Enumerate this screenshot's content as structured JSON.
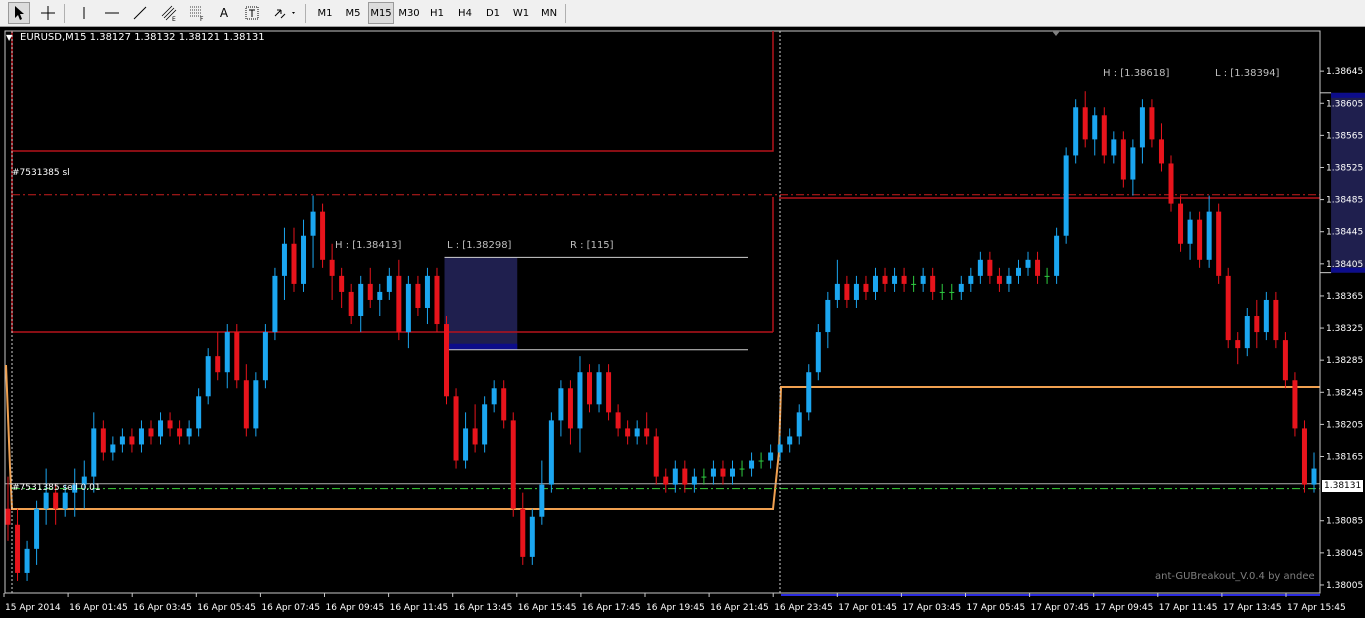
{
  "toolbar": {
    "tools": [
      {
        "name": "cursor-icon"
      },
      {
        "name": "crosshair-icon"
      },
      {
        "name": "vertical-line-icon"
      },
      {
        "name": "horizontal-line-icon"
      },
      {
        "name": "trendline-icon"
      },
      {
        "name": "equidistant-channel-icon"
      },
      {
        "name": "fibonacci-icon"
      },
      {
        "name": "text-icon",
        "label": "A"
      },
      {
        "name": "text-label-icon"
      },
      {
        "name": "arrows-dropdown-icon"
      }
    ],
    "timeframes": [
      "M1",
      "M5",
      "M15",
      "M30",
      "H1",
      "H4",
      "D1",
      "W1",
      "MN"
    ],
    "active_timeframe": "M15"
  },
  "chart": {
    "header": "EURUSD,M15  1.38127 1.38132 1.38121 1.38131",
    "current_price_label": "1.38131",
    "watermark": "ant-GUBreakout_V.0.4 by andee",
    "order_sl_label": "#7531385 sl",
    "order_sell_label": "#7531385 sell 0.01",
    "box1": {
      "high": "H : [1.38413]",
      "low": "L : [1.38298]",
      "range": "R : [115]"
    },
    "box2": {
      "high": "H : [1.38618]",
      "low": "L : [1.38394]"
    },
    "colors": {
      "background": "#000000",
      "bull": "#1ba6f0",
      "bear": "#e8141c",
      "range_box": "#1f1f4e",
      "channel": "#b5121b",
      "orange": "#f0a050",
      "grid_text": "#ffffff",
      "dash_green": "#3ad03a"
    }
  },
  "chart_data": {
    "type": "candlestick",
    "symbol": "EURUSD",
    "timeframe": "M15",
    "ylim": [
      1.37995,
      1.38695
    ],
    "y_ticks": [
      "1.38645",
      "1.38605",
      "1.38565",
      "1.38525",
      "1.38485",
      "1.38445",
      "1.38405",
      "1.38365",
      "1.38325",
      "1.38285",
      "1.38245",
      "1.38205",
      "1.38165",
      "1.38131",
      "1.38085",
      "1.38045",
      "1.38005"
    ],
    "x_ticks": [
      "15 Apr 2014",
      "16 Apr 01:45",
      "16 Apr 03:45",
      "16 Apr 05:45",
      "16 Apr 07:45",
      "16 Apr 09:45",
      "16 Apr 11:45",
      "16 Apr 13:45",
      "16 Apr 15:45",
      "16 Apr 17:45",
      "16 Apr 19:45",
      "16 Apr 21:45",
      "16 Apr 23:45",
      "17 Apr 01:45",
      "17 Apr 03:45",
      "17 Apr 05:45",
      "17 Apr 07:45",
      "17 Apr 09:45",
      "17 Apr 11:45",
      "17 Apr 13:45",
      "17 Apr 15:45"
    ],
    "levels": {
      "order_sl": 1.38491,
      "order_entry": 1.38125,
      "current_bid": 1.38131,
      "box1_high": 1.38413,
      "box1_low": 1.38298,
      "box2_high": 1.38618,
      "box2_low": 1.38394
    },
    "candles": [
      [
        1.381,
        1.3814,
        1.3806,
        1.3808
      ],
      [
        1.3808,
        1.381,
        1.3801,
        1.3802
      ],
      [
        1.3802,
        1.3806,
        1.3801,
        1.3805
      ],
      [
        1.3805,
        1.3811,
        1.3803,
        1.381
      ],
      [
        1.381,
        1.3815,
        1.3808,
        1.3812
      ],
      [
        1.3812,
        1.3813,
        1.3808,
        1.381
      ],
      [
        1.381,
        1.3813,
        1.3809,
        1.3812
      ],
      [
        1.3812,
        1.3815,
        1.3809,
        1.3813
      ],
      [
        1.3813,
        1.3816,
        1.381,
        1.3814
      ],
      [
        1.3814,
        1.3822,
        1.3812,
        1.382
      ],
      [
        1.382,
        1.3821,
        1.3816,
        1.3817
      ],
      [
        1.3817,
        1.3819,
        1.3816,
        1.3818
      ],
      [
        1.3818,
        1.382,
        1.3817,
        1.3819
      ],
      [
        1.3819,
        1.382,
        1.3817,
        1.3818
      ],
      [
        1.3818,
        1.3821,
        1.3817,
        1.382
      ],
      [
        1.382,
        1.3821,
        1.3818,
        1.3819
      ],
      [
        1.3819,
        1.3822,
        1.3818,
        1.3821
      ],
      [
        1.3821,
        1.3822,
        1.3819,
        1.382
      ],
      [
        1.382,
        1.3821,
        1.3818,
        1.3819
      ],
      [
        1.3819,
        1.3821,
        1.3818,
        1.382
      ],
      [
        1.382,
        1.3825,
        1.3819,
        1.3824
      ],
      [
        1.3824,
        1.383,
        1.3823,
        1.3829
      ],
      [
        1.3829,
        1.3832,
        1.3826,
        1.3827
      ],
      [
        1.3827,
        1.3833,
        1.3825,
        1.3832
      ],
      [
        1.3832,
        1.3833,
        1.3825,
        1.3826
      ],
      [
        1.3826,
        1.3828,
        1.3819,
        1.382
      ],
      [
        1.382,
        1.3827,
        1.3819,
        1.3826
      ],
      [
        1.3826,
        1.3833,
        1.3825,
        1.3832
      ],
      [
        1.3832,
        1.384,
        1.3831,
        1.3839
      ],
      [
        1.3839,
        1.3845,
        1.3836,
        1.3843
      ],
      [
        1.3843,
        1.3845,
        1.3837,
        1.3838
      ],
      [
        1.3838,
        1.3846,
        1.3837,
        1.3844
      ],
      [
        1.3844,
        1.3849,
        1.384,
        1.3847
      ],
      [
        1.3847,
        1.3848,
        1.384,
        1.3841
      ],
      [
        1.3841,
        1.3843,
        1.3836,
        1.3839
      ],
      [
        1.3839,
        1.384,
        1.3835,
        1.3837
      ],
      [
        1.3837,
        1.3838,
        1.3833,
        1.3834
      ],
      [
        1.3834,
        1.3839,
        1.3832,
        1.3838
      ],
      [
        1.3838,
        1.384,
        1.3835,
        1.3836
      ],
      [
        1.3836,
        1.3838,
        1.3834,
        1.3837
      ],
      [
        1.3837,
        1.384,
        1.3836,
        1.3839
      ],
      [
        1.3839,
        1.3841,
        1.3831,
        1.3832
      ],
      [
        1.3832,
        1.3839,
        1.383,
        1.3838
      ],
      [
        1.3838,
        1.3839,
        1.3834,
        1.3835
      ],
      [
        1.3835,
        1.384,
        1.3833,
        1.3839
      ],
      [
        1.3839,
        1.384,
        1.3832,
        1.3833
      ],
      [
        1.3833,
        1.3834,
        1.3823,
        1.3824
      ],
      [
        1.3824,
        1.3825,
        1.3815,
        1.3816
      ],
      [
        1.3816,
        1.3822,
        1.3815,
        1.382
      ],
      [
        1.382,
        1.3823,
        1.3817,
        1.3818
      ],
      [
        1.3818,
        1.3824,
        1.3817,
        1.3823
      ],
      [
        1.3823,
        1.3826,
        1.3822,
        1.3825
      ],
      [
        1.3825,
        1.3826,
        1.382,
        1.3821
      ],
      [
        1.3821,
        1.3822,
        1.3809,
        1.381
      ],
      [
        1.381,
        1.3812,
        1.3803,
        1.3804
      ],
      [
        1.3804,
        1.381,
        1.3803,
        1.3809
      ],
      [
        1.3809,
        1.3816,
        1.3808,
        1.3813
      ],
      [
        1.3813,
        1.3822,
        1.3812,
        1.3821
      ],
      [
        1.3821,
        1.3826,
        1.3819,
        1.3825
      ],
      [
        1.3825,
        1.3826,
        1.3818,
        1.382
      ],
      [
        1.382,
        1.3829,
        1.3817,
        1.3827
      ],
      [
        1.3827,
        1.3828,
        1.3822,
        1.3823
      ],
      [
        1.3823,
        1.3828,
        1.3822,
        1.3827
      ],
      [
        1.3827,
        1.3828,
        1.3821,
        1.3822
      ],
      [
        1.3822,
        1.3823,
        1.3819,
        1.382
      ],
      [
        1.382,
        1.3821,
        1.3818,
        1.3819
      ],
      [
        1.3819,
        1.3821,
        1.3818,
        1.382
      ],
      [
        1.382,
        1.3822,
        1.3818,
        1.3819
      ],
      [
        1.3819,
        1.382,
        1.3813,
        1.3814
      ],
      [
        1.3814,
        1.3815,
        1.3812,
        1.3813
      ],
      [
        1.3813,
        1.3816,
        1.3812,
        1.3815
      ],
      [
        1.3815,
        1.3816,
        1.3812,
        1.3813
      ],
      [
        1.3813,
        1.3815,
        1.3812,
        1.3814
      ],
      [
        1.3814,
        1.3815,
        1.3813,
        1.3814
      ],
      [
        1.3814,
        1.3816,
        1.3813,
        1.3815
      ],
      [
        1.3815,
        1.3816,
        1.3813,
        1.3814
      ],
      [
        1.3814,
        1.3816,
        1.3813,
        1.3815
      ],
      [
        1.3815,
        1.3816,
        1.3814,
        1.3815
      ],
      [
        1.3815,
        1.3817,
        1.3814,
        1.3816
      ],
      [
        1.3816,
        1.3817,
        1.3815,
        1.3816
      ],
      [
        1.3816,
        1.3818,
        1.3815,
        1.3817
      ],
      [
        1.3817,
        1.3819,
        1.3816,
        1.3818
      ],
      [
        1.3818,
        1.382,
        1.3817,
        1.3819
      ],
      [
        1.3819,
        1.3823,
        1.3818,
        1.3822
      ],
      [
        1.3822,
        1.3828,
        1.3821,
        1.3827
      ],
      [
        1.3827,
        1.3833,
        1.3826,
        1.3832
      ],
      [
        1.3832,
        1.3837,
        1.383,
        1.3836
      ],
      [
        1.3836,
        1.3841,
        1.3835,
        1.3838
      ],
      [
        1.3838,
        1.3839,
        1.3835,
        1.3836
      ],
      [
        1.3836,
        1.3839,
        1.3835,
        1.3838
      ],
      [
        1.3838,
        1.3839,
        1.3836,
        1.3837
      ],
      [
        1.3837,
        1.384,
        1.3836,
        1.3839
      ],
      [
        1.3839,
        1.384,
        1.3837,
        1.3838
      ],
      [
        1.3838,
        1.384,
        1.3837,
        1.3839
      ],
      [
        1.3839,
        1.384,
        1.3837,
        1.3838
      ],
      [
        1.3838,
        1.3839,
        1.3837,
        1.3838
      ],
      [
        1.3838,
        1.384,
        1.3837,
        1.3839
      ],
      [
        1.3839,
        1.384,
        1.3836,
        1.3837
      ],
      [
        1.3837,
        1.3838,
        1.3836,
        1.3837
      ],
      [
        1.3837,
        1.3838,
        1.3836,
        1.3837
      ],
      [
        1.3837,
        1.3839,
        1.3836,
        1.3838
      ],
      [
        1.3838,
        1.384,
        1.3837,
        1.3839
      ],
      [
        1.3839,
        1.3842,
        1.3838,
        1.3841
      ],
      [
        1.3841,
        1.3842,
        1.3838,
        1.3839
      ],
      [
        1.3839,
        1.384,
        1.3837,
        1.3838
      ],
      [
        1.3838,
        1.384,
        1.3837,
        1.3839
      ],
      [
        1.3839,
        1.3841,
        1.3838,
        1.384
      ],
      [
        1.384,
        1.3842,
        1.3839,
        1.3841
      ],
      [
        1.3841,
        1.3842,
        1.3838,
        1.3839
      ],
      [
        1.3839,
        1.384,
        1.3838,
        1.3839
      ],
      [
        1.3839,
        1.3845,
        1.3838,
        1.3844
      ],
      [
        1.3844,
        1.3855,
        1.3843,
        1.3854
      ],
      [
        1.3854,
        1.3861,
        1.3853,
        1.386
      ],
      [
        1.386,
        1.3862,
        1.3855,
        1.3856
      ],
      [
        1.3856,
        1.386,
        1.3854,
        1.3859
      ],
      [
        1.3859,
        1.386,
        1.3853,
        1.3854
      ],
      [
        1.3854,
        1.3857,
        1.3853,
        1.3856
      ],
      [
        1.3856,
        1.3857,
        1.385,
        1.3851
      ],
      [
        1.3851,
        1.3856,
        1.3849,
        1.3855
      ],
      [
        1.3855,
        1.3861,
        1.3853,
        1.386
      ],
      [
        1.386,
        1.3861,
        1.3855,
        1.3856
      ],
      [
        1.3856,
        1.3858,
        1.3852,
        1.3853
      ],
      [
        1.3853,
        1.3854,
        1.3847,
        1.3848
      ],
      [
        1.3848,
        1.3849,
        1.3842,
        1.3843
      ],
      [
        1.3843,
        1.3847,
        1.3841,
        1.3846
      ],
      [
        1.3846,
        1.3847,
        1.384,
        1.3841
      ],
      [
        1.3841,
        1.3849,
        1.384,
        1.3847
      ],
      [
        1.3847,
        1.3848,
        1.3838,
        1.3839
      ],
      [
        1.3839,
        1.384,
        1.383,
        1.3831
      ],
      [
        1.3831,
        1.3832,
        1.3828,
        1.383
      ],
      [
        1.383,
        1.3835,
        1.3829,
        1.3834
      ],
      [
        1.3834,
        1.3836,
        1.383,
        1.3832
      ],
      [
        1.3832,
        1.3837,
        1.3831,
        1.3836
      ],
      [
        1.3836,
        1.3837,
        1.383,
        1.3831
      ],
      [
        1.3831,
        1.3832,
        1.3825,
        1.3826
      ],
      [
        1.3826,
        1.3827,
        1.3819,
        1.382
      ],
      [
        1.382,
        1.3821,
        1.3812,
        1.3813
      ],
      [
        1.3813,
        1.3817,
        1.3812,
        1.3815
      ]
    ]
  }
}
